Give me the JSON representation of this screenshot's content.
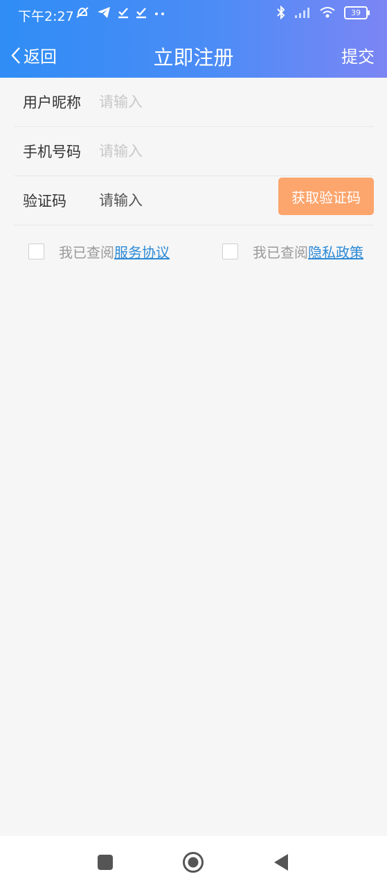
{
  "status_bar": {
    "time": "下午2:27",
    "battery": "39"
  },
  "nav": {
    "back_label": "返回",
    "title": "立即注册",
    "submit_label": "提交"
  },
  "form": {
    "nickname": {
      "label": "用户昵称",
      "placeholder": "请输入"
    },
    "phone": {
      "label": "手机号码",
      "placeholder": "请输入"
    },
    "code": {
      "label": "验证码",
      "placeholder": "请输入",
      "button_label": "获取验证码"
    }
  },
  "agreements": {
    "service": {
      "prefix": "我已查阅",
      "link": "服务协议",
      "checked": false
    },
    "privacy": {
      "prefix": "我已查阅",
      "link": "隐私政策",
      "checked": false
    }
  },
  "colors": {
    "header_gradient": [
      "#2f8df5",
      "#7b86f4"
    ],
    "code_button": "#fca56d",
    "link": "#2d8ad6"
  }
}
